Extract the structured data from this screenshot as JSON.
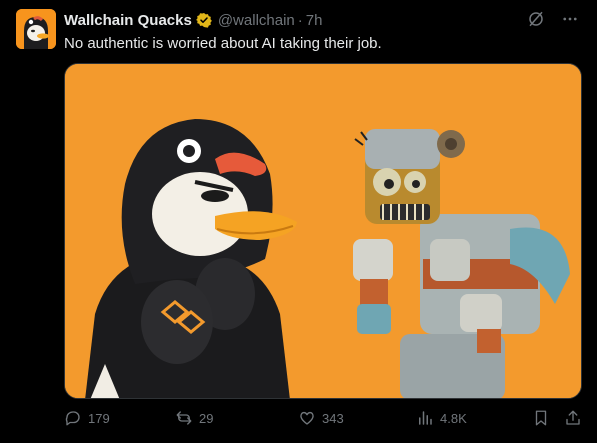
{
  "tweet": {
    "author_name": "Wallchain Quacks",
    "handle": "@wallchain",
    "separator": "·",
    "time": "7h",
    "text": "No authentic is worried about AI taking their job."
  },
  "actions": {
    "replies": "179",
    "reposts": "29",
    "likes": "343",
    "views": "4.8K"
  },
  "icons": {
    "verified": "verified-badge-icon",
    "grok": "grok-icon",
    "more": "more-icon",
    "reply": "reply-icon",
    "repost": "repost-icon",
    "like": "like-icon",
    "views": "views-icon",
    "bookmark": "bookmark-icon",
    "share": "share-icon"
  },
  "colors": {
    "background": "#000000",
    "media_background": "#f39a2d",
    "verified_gold": "#e2b719",
    "muted_text": "#71767b",
    "text": "#e7e9ea"
  }
}
